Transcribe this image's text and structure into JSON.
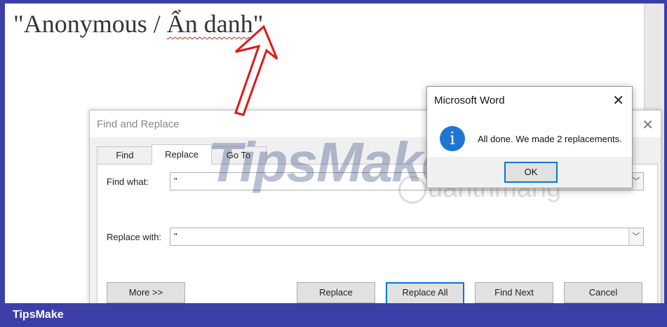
{
  "document": {
    "text_prefix": "\"Anonymous / ",
    "text_misspelled": "Ẩn danh",
    "text_suffix": "\""
  },
  "find_replace": {
    "title": "Find and Replace",
    "close_glyph": "✕",
    "tabs": [
      {
        "label": "Find",
        "active": false
      },
      {
        "label": "Replace",
        "active": true
      },
      {
        "label": "Go To",
        "active": false
      }
    ],
    "find_what_label": "Find what:",
    "find_what_value": "\"",
    "replace_with_label": "Replace with:",
    "replace_with_value": "\"",
    "buttons": {
      "more": "More >>",
      "replace": "Replace",
      "replace_all": "Replace All",
      "find_next": "Find Next",
      "cancel": "Cancel"
    }
  },
  "message_box": {
    "title": "Microsoft Word",
    "close_glyph": "✕",
    "icon": "info-icon",
    "message": "All done. We made 2 replacements.",
    "ok_label": "OK"
  },
  "watermarks": {
    "tipsmake": "TipsMake",
    "quantrimang": "uantrimang"
  },
  "footer": {
    "brand": "TipsMake"
  },
  "colors": {
    "frame": "#3c3fa8",
    "arrow": "#e01818",
    "info_icon": "#1e76d2",
    "focus_border": "#0078d7"
  }
}
